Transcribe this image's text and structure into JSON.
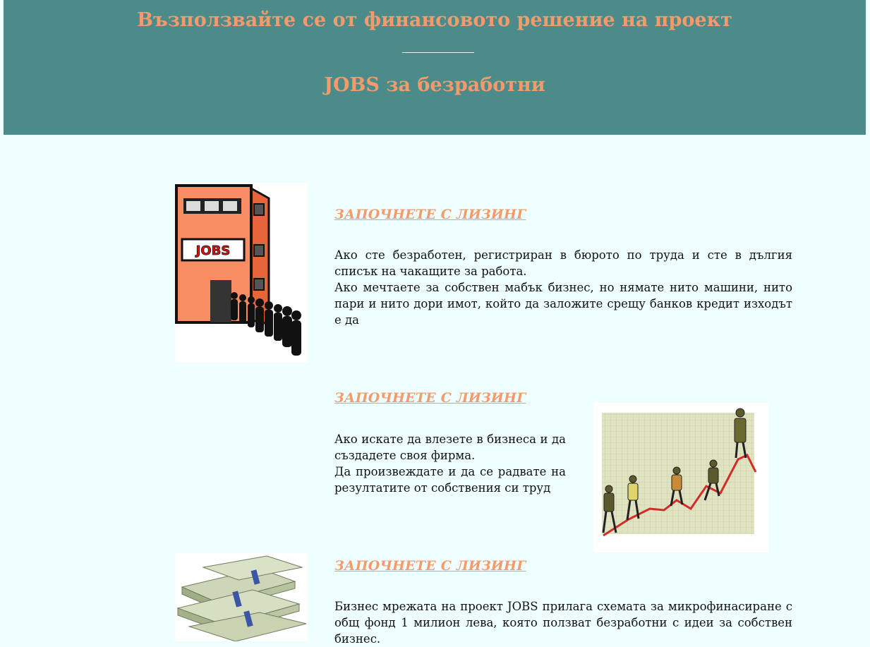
{
  "header": {
    "title_line1": "Възползвайте се от финансовото решение на проект",
    "title_line2": "JOBS за безработни"
  },
  "sections": [
    {
      "heading": "ЗАПОЧНЕТЕ С ЛИЗИНГ",
      "paragraphs": [
        "Ако сте безработен, регистриран в бюрото по труда и сте в дългия списък на чакащите за работа.",
        "Ако мечтаете за собствен мабък бизнес, но нямате нито машини, нито пари и нито дори имот, който да заложите срещу банков кредит изходът е да"
      ],
      "image_label": "JOBS"
    },
    {
      "heading": "ЗАПОЧНЕТЕ С ЛИЗИНГ",
      "paragraphs": [
        "Ако искате да влезете в бизнеса и да създадете своя фирма.",
        "Да произвеждате и да се радвате на резултатите от собствения си труд"
      ]
    },
    {
      "heading": "ЗАПОЧНЕТЕ С ЛИЗИНГ",
      "paragraphs": [
        "Бизнес мрежата на проект JOBS прилага схемата за микрофинасиране с общ фонд 1 милион лева, която ползват безработни с идеи за собствен бизнес."
      ]
    }
  ],
  "colors": {
    "header_bg": "#4b8c8a",
    "accent": "#f59a6b",
    "page_bg": "#efffff"
  }
}
